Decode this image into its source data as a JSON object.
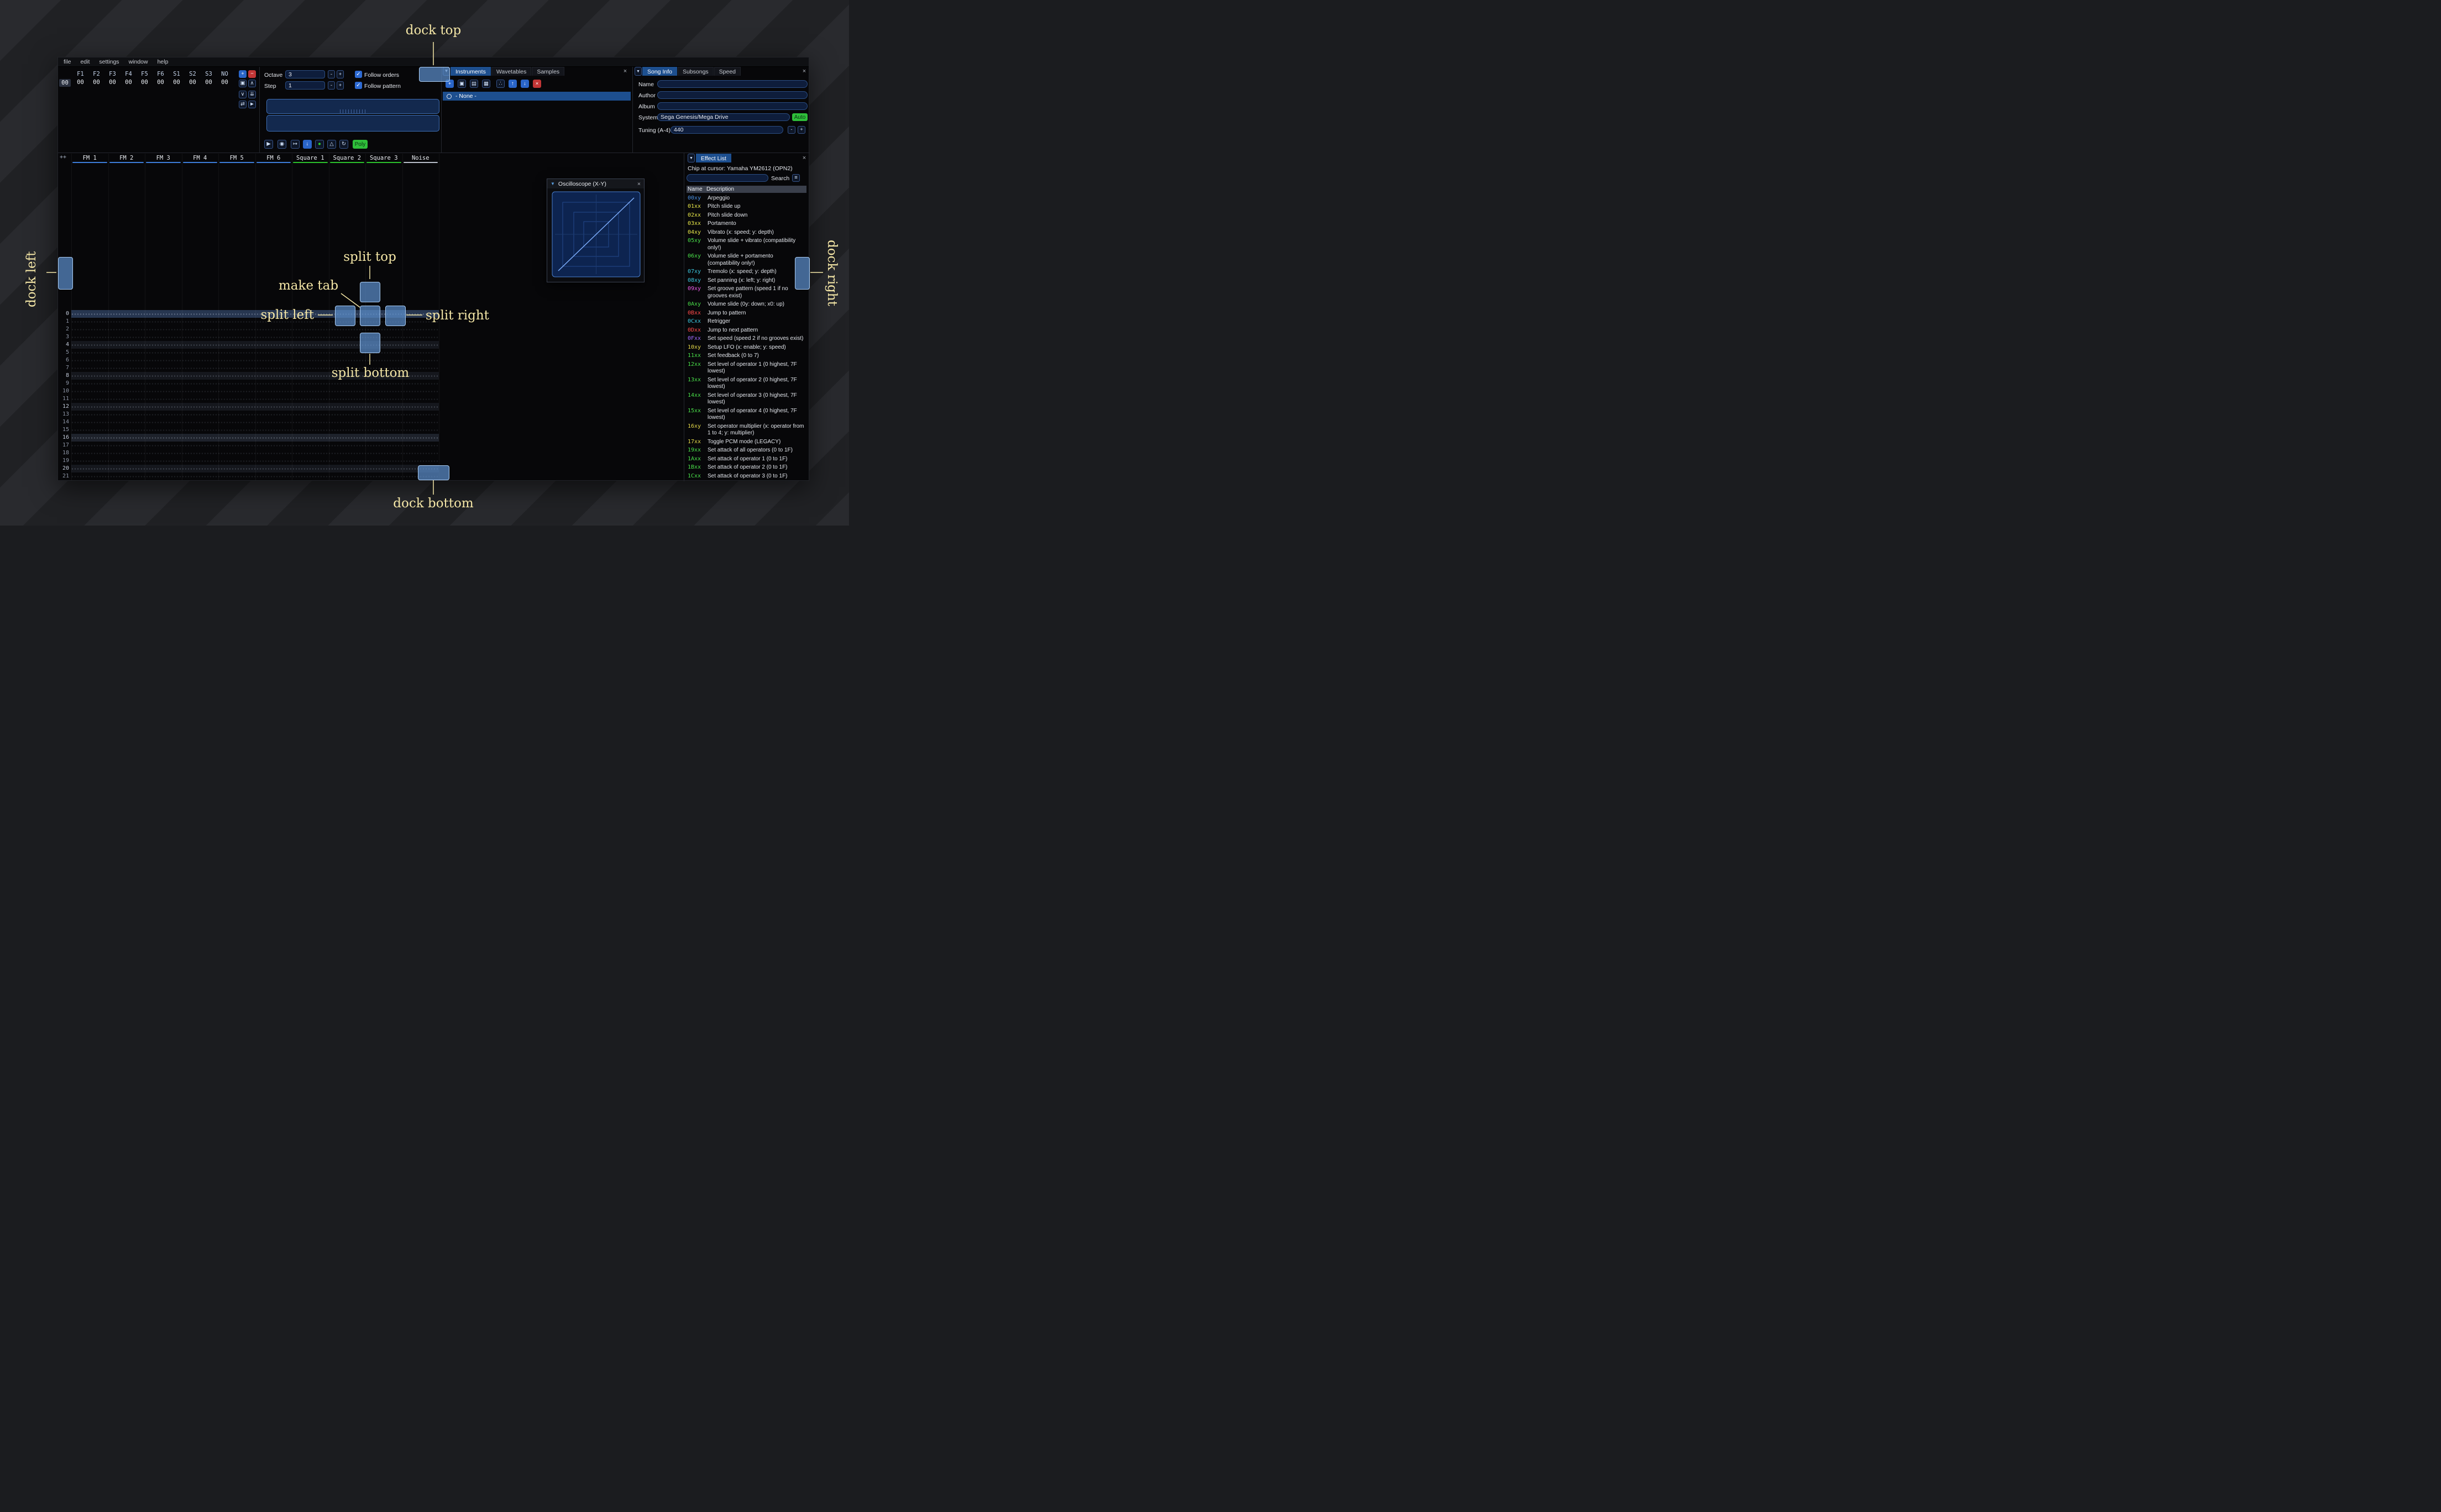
{
  "ui": {
    "icons": {
      "close": "×",
      "dropdown": "▾",
      "collapse": "▼",
      "hamburger": "≡",
      "check": "✓"
    },
    "minus": "-",
    "plus": "+",
    "accent_color": "#1d4f8f",
    "dock_overlay_fill": "#5c8dcb",
    "dock_overlay_border": "#aacdf4",
    "annotation_color": "#f4e6a6"
  },
  "menu": {
    "items": [
      "file",
      "edit",
      "settings",
      "window",
      "help"
    ]
  },
  "orders": {
    "row_label": "00",
    "column_headers": [
      "F1",
      "F2",
      "F3",
      "F4",
      "F5",
      "F6",
      "S1",
      "S2",
      "S3",
      "NO"
    ],
    "row_values": [
      "00",
      "00",
      "00",
      "00",
      "00",
      "00",
      "00",
      "00",
      "00",
      "00"
    ],
    "buttons": [
      {
        "name": "add-order-button",
        "icon": "plus-icon",
        "glyph": "+",
        "variant": "blue-solid"
      },
      {
        "name": "remove-order-button",
        "icon": "minus-icon",
        "glyph": "−",
        "variant": "red-solid"
      },
      {
        "name": "duplicate-order-button",
        "icon": "duplicate-icon",
        "glyph": "▣",
        "variant": "outline"
      },
      {
        "name": "move-order-up-button",
        "icon": "chevron-up-icon",
        "glyph": "∧",
        "variant": "outline"
      },
      {
        "name": "move-order-down-button",
        "icon": "chevron-down-icon",
        "glyph": "∨",
        "variant": "outline"
      },
      {
        "name": "duplicate-order-end-button",
        "icon": "double-down-icon",
        "glyph": "⇊",
        "variant": "outline"
      },
      {
        "name": "order-change-mode-button",
        "icon": "swap-icon",
        "glyph": "⇄",
        "variant": "outline"
      },
      {
        "name": "order-click-mode-button",
        "icon": "cursor-icon",
        "glyph": "►",
        "variant": "outline"
      }
    ]
  },
  "controls": {
    "octave_label": "Octave",
    "octave_value": "3",
    "step_label": "Step",
    "step_value": "1",
    "follow_orders": "Follow orders",
    "follow_pattern": "Follow pattern",
    "poly_label": "Poly",
    "transport": [
      {
        "name": "play-button",
        "icon": "play-icon",
        "glyph": "▶",
        "variant": "outline"
      },
      {
        "name": "play-pattern-button",
        "icon": "play-circle-icon",
        "glyph": "◉",
        "variant": "outline"
      },
      {
        "name": "play-from-cursor-button",
        "icon": "play-to-bar-icon",
        "glyph": "↦",
        "variant": "outline"
      },
      {
        "name": "step-row-button",
        "icon": "arrow-down-icon",
        "glyph": "↓",
        "variant": "blue-solid"
      },
      {
        "name": "stop-button",
        "icon": "record-circle-icon",
        "glyph": "●",
        "variant": "green-glyph"
      },
      {
        "name": "metronome-button",
        "icon": "metronome-icon",
        "glyph": "△",
        "variant": "outline"
      },
      {
        "name": "repeat-pattern-button",
        "icon": "repeat-icon",
        "glyph": "↻",
        "variant": "outline"
      }
    ]
  },
  "instruments": {
    "tabs": [
      {
        "label": "Instruments",
        "selected": true
      },
      {
        "label": "Wavetables",
        "selected": false
      },
      {
        "label": "Samples",
        "selected": false
      }
    ],
    "toolbar": [
      {
        "name": "add-instrument-button",
        "icon": "plus-icon",
        "glyph": "+",
        "variant": "blue-solid"
      },
      {
        "name": "duplicate-instrument-button",
        "icon": "duplicate-icon",
        "glyph": "▣",
        "variant": "outline"
      },
      {
        "name": "open-instrument-button",
        "icon": "folder-icon",
        "glyph": "▤",
        "variant": "outline"
      },
      {
        "name": "save-instrument-button",
        "icon": "save-icon",
        "glyph": "▦",
        "variant": "outline"
      },
      {
        "name": "instrument-dir-button",
        "icon": "sitemap-icon",
        "glyph": "∴",
        "variant": "outline"
      },
      {
        "name": "move-instrument-up-button",
        "icon": "arrow-up-icon",
        "glyph": "↑",
        "variant": "blue-solid"
      },
      {
        "name": "move-instrument-down-button",
        "icon": "arrow-down-icon",
        "glyph": "↓",
        "variant": "blue-solid"
      },
      {
        "name": "delete-instrument-button",
        "icon": "delete-icon",
        "glyph": "×",
        "variant": "red-solid"
      }
    ],
    "none_item": "- None -"
  },
  "song_info": {
    "tabs": [
      {
        "label": "Song Info",
        "selected": true
      },
      {
        "label": "Subsongs",
        "selected": false
      },
      {
        "label": "Speed",
        "selected": false
      }
    ],
    "name_label": "Name",
    "name_value": "",
    "author_label": "Author",
    "author_value": "",
    "album_label": "Album",
    "album_value": "",
    "system_label": "System",
    "system_value": "Sega Genesis/Mega Drive",
    "auto_label": "Auto",
    "tuning_label": "Tuning (A-4)",
    "tuning_value": "440"
  },
  "pattern": {
    "corner_label": "++",
    "channels": [
      {
        "name": "FM 1",
        "color": "#3d7dd9"
      },
      {
        "name": "FM 2",
        "color": "#3d7dd9"
      },
      {
        "name": "FM 3",
        "color": "#3d7dd9"
      },
      {
        "name": "FM 4",
        "color": "#3d7dd9"
      },
      {
        "name": "FM 5",
        "color": "#3d7dd9"
      },
      {
        "name": "FM 6",
        "color": "#3d7dd9"
      },
      {
        "name": "Square 1",
        "color": "#2bc12b"
      },
      {
        "name": "Square 2",
        "color": "#2bc12b"
      },
      {
        "name": "Square 3",
        "color": "#2bc12b"
      },
      {
        "name": "Noise",
        "color": "#b9bfca"
      }
    ],
    "row_numbers": [
      "0",
      "1",
      "2",
      "3",
      "4",
      "5",
      "6",
      "7",
      "8",
      "9",
      "10",
      "11",
      "12",
      "13",
      "14",
      "15",
      "16",
      "17",
      "18",
      "19",
      "20",
      "21"
    ]
  },
  "oscilloscope": {
    "title": "Oscilloscope (X-Y)"
  },
  "effect_list": {
    "tab_label": "Effect List",
    "chip_line": "Chip at cursor: Yamaha YM2612 (OPN2)",
    "search_label": "Search",
    "search_value": "",
    "columns": [
      "Name",
      "Description"
    ],
    "colors": {
      "misc": "#4a90e2",
      "pitch": "#e8e84a",
      "volume": "#4ae04a",
      "panning": "#3cc8e0",
      "time": "#3cc8e0",
      "song": "#ff4a4a",
      "groove": "#eb5ce8",
      "speed": "#a06aff",
      "chip_primary": "#e5d94a",
      "chip_secondary": "#4ae04a"
    },
    "effects": [
      {
        "code": "00xy",
        "type": "misc",
        "desc": "Arpeggio"
      },
      {
        "code": "01xx",
        "type": "pitch",
        "desc": "Pitch slide up"
      },
      {
        "code": "02xx",
        "type": "pitch",
        "desc": "Pitch slide down"
      },
      {
        "code": "03xx",
        "type": "pitch",
        "desc": "Portamento"
      },
      {
        "code": "04xy",
        "type": "pitch",
        "desc": "Vibrato (x: speed; y: depth)"
      },
      {
        "code": "05xy",
        "type": "volume",
        "desc": "Volume slide + vibrato (compatibility only!)"
      },
      {
        "code": "06xy",
        "type": "volume",
        "desc": "Volume slide + portamento (compatibility only!)"
      },
      {
        "code": "07xy",
        "type": "panning",
        "desc": "Tremolo (x: speed; y: depth)"
      },
      {
        "code": "08xy",
        "type": "panning",
        "desc": "Set panning (x: left; y: right)"
      },
      {
        "code": "09xy",
        "type": "groove",
        "desc": "Set groove pattern (speed 1 if no grooves exist)"
      },
      {
        "code": "0Axy",
        "type": "volume",
        "desc": "Volume slide (0y: down; x0: up)"
      },
      {
        "code": "0Bxx",
        "type": "song",
        "desc": "Jump to pattern"
      },
      {
        "code": "0Cxx",
        "type": "time",
        "desc": "Retrigger"
      },
      {
        "code": "0Dxx",
        "type": "song",
        "desc": "Jump to next pattern"
      },
      {
        "code": "0Fxx",
        "type": "speed",
        "desc": "Set speed (speed 2 if no grooves exist)"
      },
      {
        "code": "10xy",
        "type": "chip_primary",
        "desc": "Setup LFO (x: enable; y: speed)"
      },
      {
        "code": "11xx",
        "type": "chip_secondary",
        "desc": "Set feedback (0 to 7)"
      },
      {
        "code": "12xx",
        "type": "chip_secondary",
        "desc": "Set level of operator 1 (0 highest, 7F lowest)"
      },
      {
        "code": "13xx",
        "type": "chip_secondary",
        "desc": "Set level of operator 2 (0 highest, 7F lowest)"
      },
      {
        "code": "14xx",
        "type": "chip_secondary",
        "desc": "Set level of operator 3 (0 highest, 7F lowest)"
      },
      {
        "code": "15xx",
        "type": "chip_secondary",
        "desc": "Set level of operator 4 (0 highest, 7F lowest)"
      },
      {
        "code": "16xy",
        "type": "chip_primary",
        "desc": "Set operator multiplier (x: operator from 1 to 4; y: multiplier)"
      },
      {
        "code": "17xx",
        "type": "chip_primary",
        "desc": "Toggle PCM mode (LEGACY)"
      },
      {
        "code": "19xx",
        "type": "chip_secondary",
        "desc": "Set attack of all operators (0 to 1F)"
      },
      {
        "code": "1Axx",
        "type": "chip_secondary",
        "desc": "Set attack of operator 1 (0 to 1F)"
      },
      {
        "code": "1Bxx",
        "type": "chip_secondary",
        "desc": "Set attack of operator 2 (0 to 1F)"
      },
      {
        "code": "1Cxx",
        "type": "chip_secondary",
        "desc": "Set attack of operator 3 (0 to 1F)"
      }
    ]
  },
  "annotations": {
    "dock_top": "dock top",
    "dock_bottom": "dock bottom",
    "dock_left": "dock left",
    "dock_right": "dock right",
    "split_top": "split top",
    "split_bottom": "split bottom",
    "split_left": "split left",
    "split_right": "split right",
    "make_tab": "make tab"
  }
}
